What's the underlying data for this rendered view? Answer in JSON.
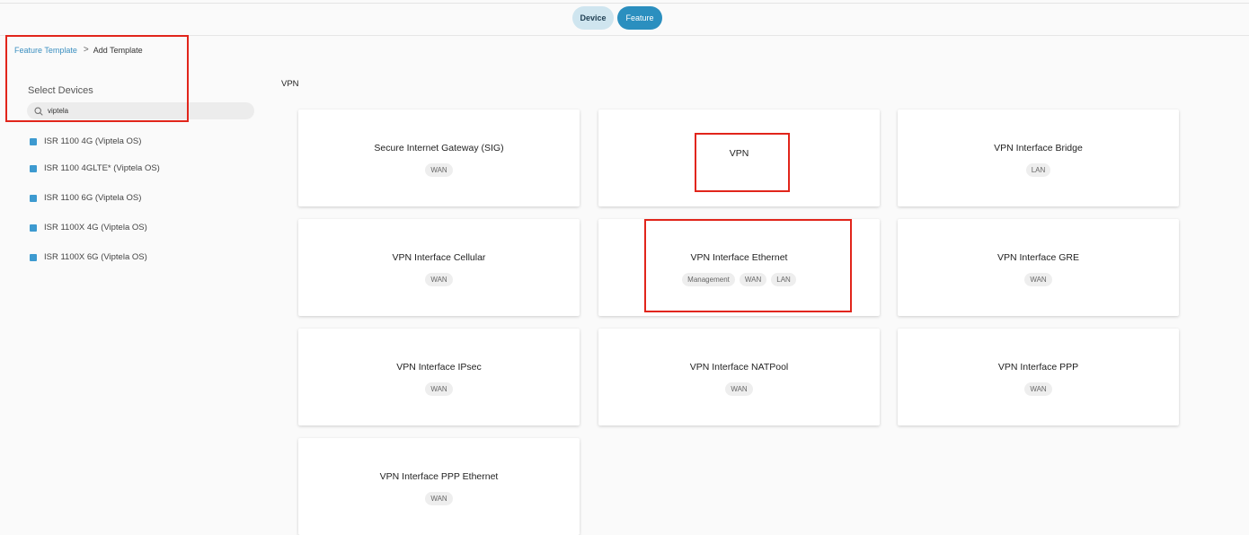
{
  "header": {
    "toggle": [
      {
        "label": "Device",
        "active": false
      },
      {
        "label": "Feature",
        "active": true
      }
    ]
  },
  "breadcrumb": {
    "link": "Feature Template",
    "separator": ">",
    "current": "Add Template"
  },
  "sidebar": {
    "select_label": "Select Devices",
    "search_value": "viptela",
    "devices": [
      {
        "label": "ISR 1100 4G (Viptela OS)",
        "checked": true
      },
      {
        "label": "ISR 1100 4GLTE* (Viptela OS)",
        "checked": true
      },
      {
        "label": "ISR 1100 6G (Viptela OS)",
        "checked": true
      },
      {
        "label": "ISR 1100X 4G (Viptela OS)",
        "checked": true
      },
      {
        "label": "ISR 1100X 6G (Viptela OS)",
        "checked": true
      }
    ]
  },
  "main": {
    "section_title": "VPN",
    "cards": [
      {
        "title": "Secure Internet Gateway (SIG)",
        "tags": [
          "WAN"
        ]
      },
      {
        "title": "VPN",
        "tags": []
      },
      {
        "title": "VPN Interface Bridge",
        "tags": [
          "LAN"
        ]
      },
      {
        "title": "VPN Interface Cellular",
        "tags": [
          "WAN"
        ]
      },
      {
        "title": "VPN Interface Ethernet",
        "tags": [
          "Management",
          "WAN",
          "LAN"
        ]
      },
      {
        "title": "VPN Interface GRE",
        "tags": [
          "WAN"
        ]
      },
      {
        "title": "VPN Interface IPsec",
        "tags": [
          "WAN"
        ]
      },
      {
        "title": "VPN Interface NATPool",
        "tags": [
          "WAN"
        ]
      },
      {
        "title": "VPN Interface PPP",
        "tags": [
          "WAN"
        ]
      },
      {
        "title": "VPN Interface PPP Ethernet",
        "tags": [
          "WAN"
        ]
      }
    ]
  },
  "colors": {
    "accent": "#2b8fbf",
    "highlight": "#e1251b",
    "checkbox": "#3d9ad0"
  }
}
